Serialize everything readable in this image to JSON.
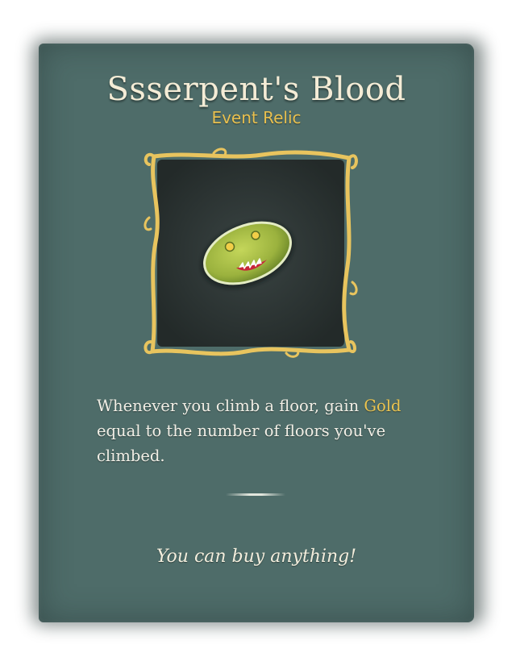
{
  "relic": {
    "name": "Ssserpent's Blood",
    "rarity": "Event Relic",
    "description_parts": {
      "before": "Whenever you climb a floor, gain ",
      "highlight": "Gold",
      "after": " equal to the number of floors you've climbed."
    },
    "flavor": "You can buy anything!",
    "icon": "ssserpent-blood-icon"
  },
  "colors": {
    "card": "#4e6c69",
    "title": "#f4ecd6",
    "rarity": "#e9c04f",
    "gold_keyword": "#ecc44f",
    "frame": "#e8c45e",
    "frame_inner": "#2c3534",
    "blob": "#9bb23e"
  }
}
